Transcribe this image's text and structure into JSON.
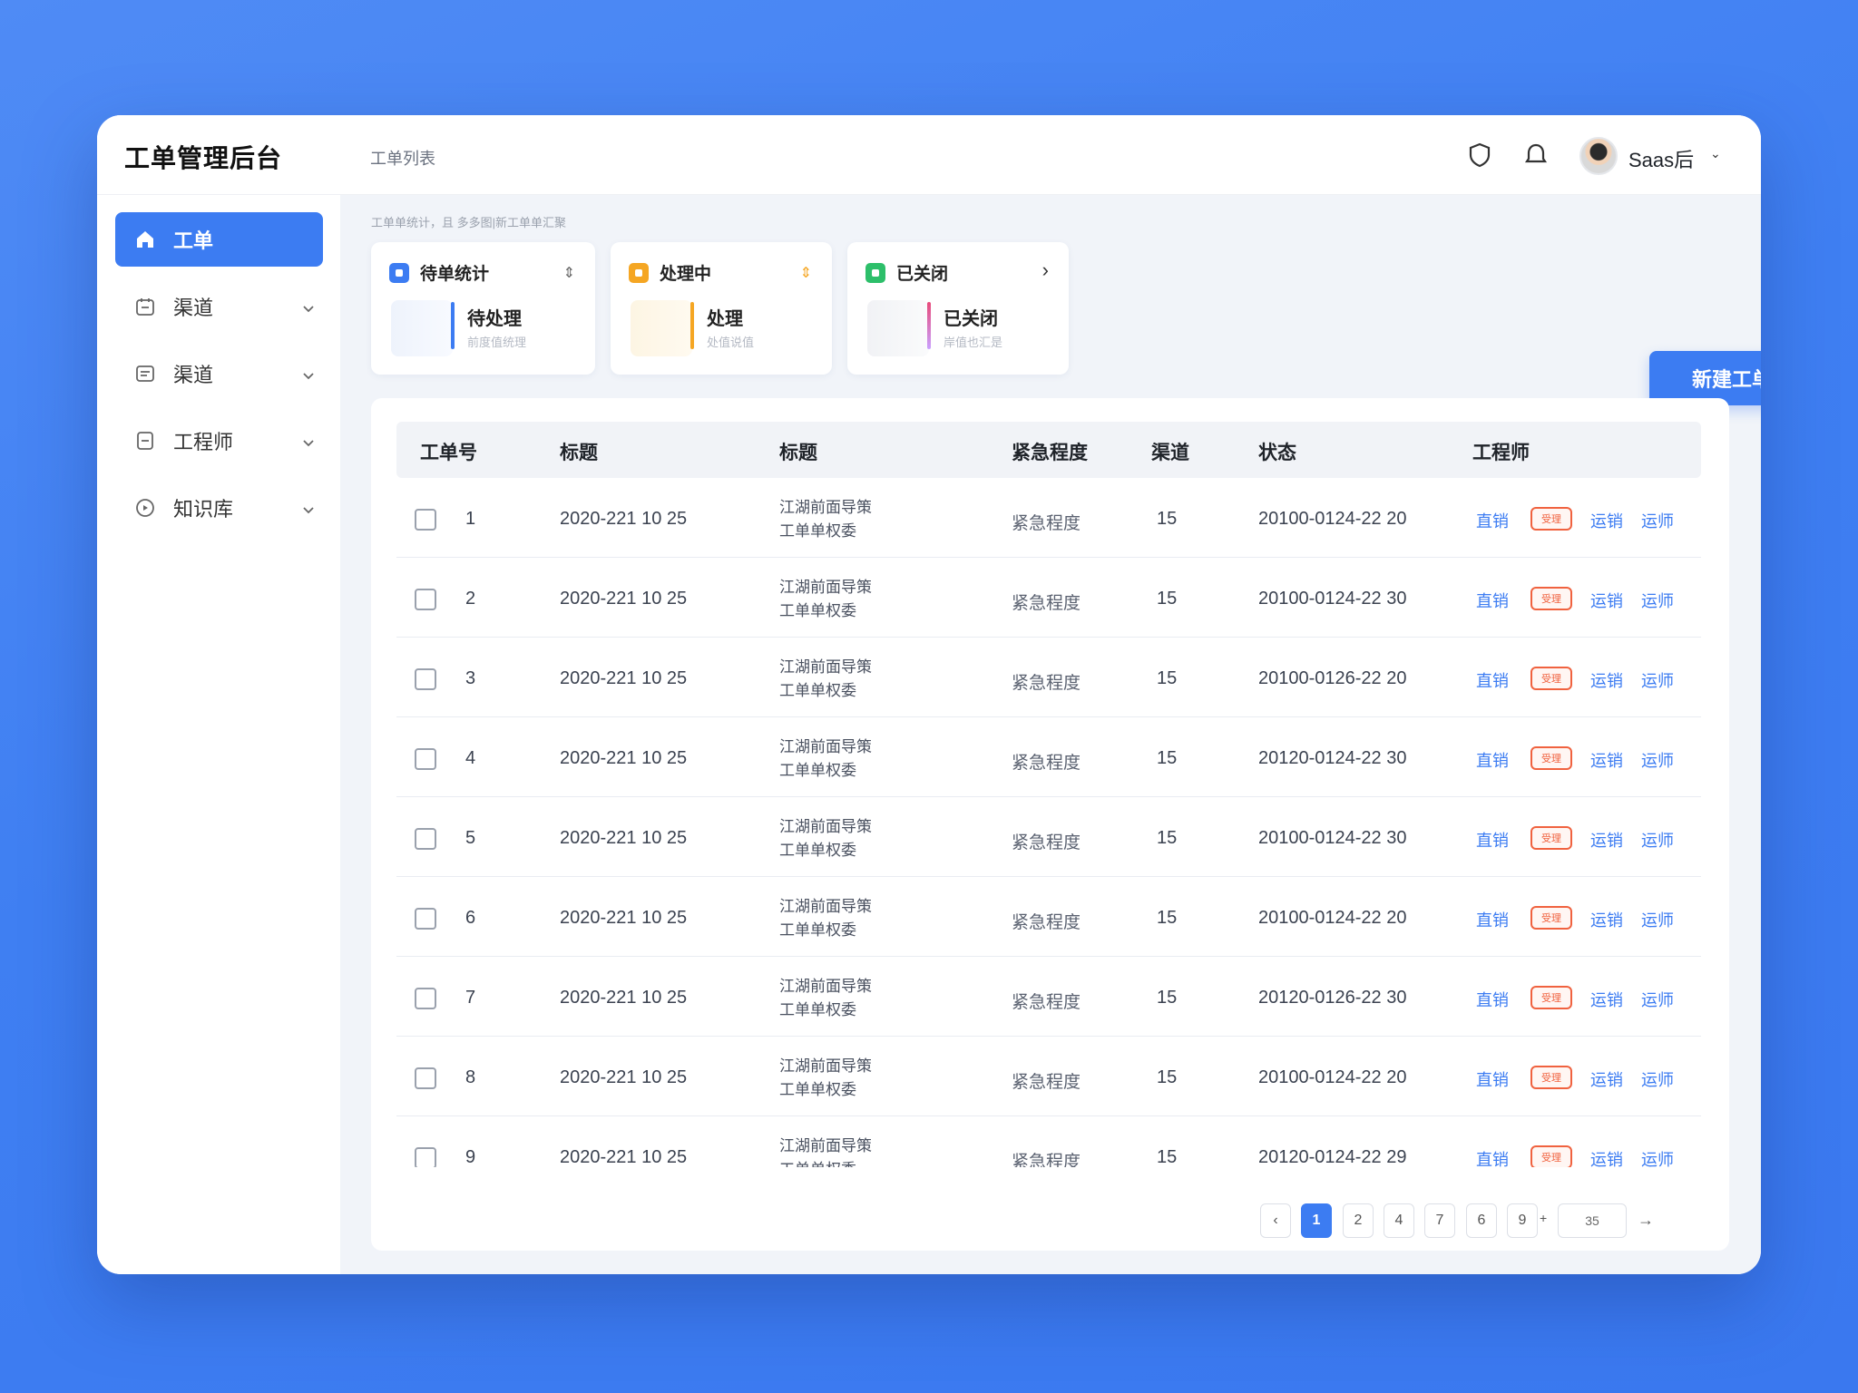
{
  "app": {
    "title": "工单管理后台"
  },
  "header": {
    "breadcrumb": "工单列表",
    "icons": [
      "shield-icon",
      "bell-icon"
    ],
    "user_name": "Saas后",
    "user_caret": "⌄"
  },
  "sidebar": {
    "items": [
      {
        "label": "工单",
        "icon": "home-icon",
        "active": true
      },
      {
        "label": "渠道",
        "icon": "calendar-icon",
        "active": false
      },
      {
        "label": "渠道",
        "icon": "list-icon",
        "active": false
      },
      {
        "label": "工程师",
        "icon": "document-icon",
        "active": false
      },
      {
        "label": "知识库",
        "icon": "compass-icon",
        "active": false
      }
    ]
  },
  "main": {
    "section_hint": "工单单统计，且 多多图|新工单单汇聚",
    "stats": [
      {
        "head": "待单统计",
        "label": "待处理",
        "sub": "前度值统理",
        "color": "#3c7cf2",
        "action": "⇕"
      },
      {
        "head": "处理中",
        "label": "处理",
        "sub": "处值说值",
        "color": "#f5a623",
        "action": "⇕"
      },
      {
        "head": "已关闭",
        "label": "已关闭",
        "sub": "岸值也汇是",
        "color": "#2dbf6a",
        "action": "›"
      }
    ],
    "new_button": "新建工单"
  },
  "table": {
    "columns": [
      "工单号",
      "标题",
      "标题",
      "紧急程度",
      "渠道",
      "状态",
      "工程师"
    ],
    "action_labels": {
      "view": "直销",
      "tag": "受理",
      "edit": "运销",
      "assign": "运师"
    },
    "rows": [
      {
        "id": "1",
        "date": "2020-221 10 25",
        "title1": "江湖前面导策",
        "title2": "工单单权委",
        "urgency": "紧急程度",
        "channel": "15",
        "status": "20100-0124-22 20"
      },
      {
        "id": "2",
        "date": "2020-221 10 25",
        "title1": "江湖前面导策",
        "title2": "工单单权委",
        "urgency": "紧急程度",
        "channel": "15",
        "status": "20100-0124-22 30"
      },
      {
        "id": "3",
        "date": "2020-221 10 25",
        "title1": "江湖前面导策",
        "title2": "工单单权委",
        "urgency": "紧急程度",
        "channel": "15",
        "status": "20100-0126-22 20"
      },
      {
        "id": "4",
        "date": "2020-221 10 25",
        "title1": "江湖前面导策",
        "title2": "工单单权委",
        "urgency": "紧急程度",
        "channel": "15",
        "status": "20120-0124-22 30"
      },
      {
        "id": "5",
        "date": "2020-221 10 25",
        "title1": "江湖前面导策",
        "title2": "工单单权委",
        "urgency": "紧急程度",
        "channel": "15",
        "status": "20100-0124-22 30"
      },
      {
        "id": "6",
        "date": "2020-221 10 25",
        "title1": "江湖前面导策",
        "title2": "工单单权委",
        "urgency": "紧急程度",
        "channel": "15",
        "status": "20100-0124-22 20"
      },
      {
        "id": "7",
        "date": "2020-221 10 25",
        "title1": "江湖前面导策",
        "title2": "工单单权委",
        "urgency": "紧急程度",
        "channel": "15",
        "status": "20120-0126-22 30"
      },
      {
        "id": "8",
        "date": "2020-221 10 25",
        "title1": "江湖前面导策",
        "title2": "工单单权委",
        "urgency": "紧急程度",
        "channel": "15",
        "status": "20100-0124-22 20"
      },
      {
        "id": "9",
        "date": "2020-221 10 25",
        "title1": "江湖前面导策",
        "title2": "工单单权委",
        "urgency": "紧急程度",
        "channel": "15",
        "status": "20120-0124-22 29"
      }
    ]
  },
  "pagination": {
    "prev": "‹",
    "pages": [
      "1",
      "2",
      "4",
      "7",
      "6",
      "9"
    ],
    "active_page": "1",
    "jump_label": "+",
    "jump_value": "35",
    "next": "→"
  },
  "colors": {
    "primary": "#3c7cf2",
    "background": "#3f7ff2",
    "danger": "#f0623f"
  }
}
